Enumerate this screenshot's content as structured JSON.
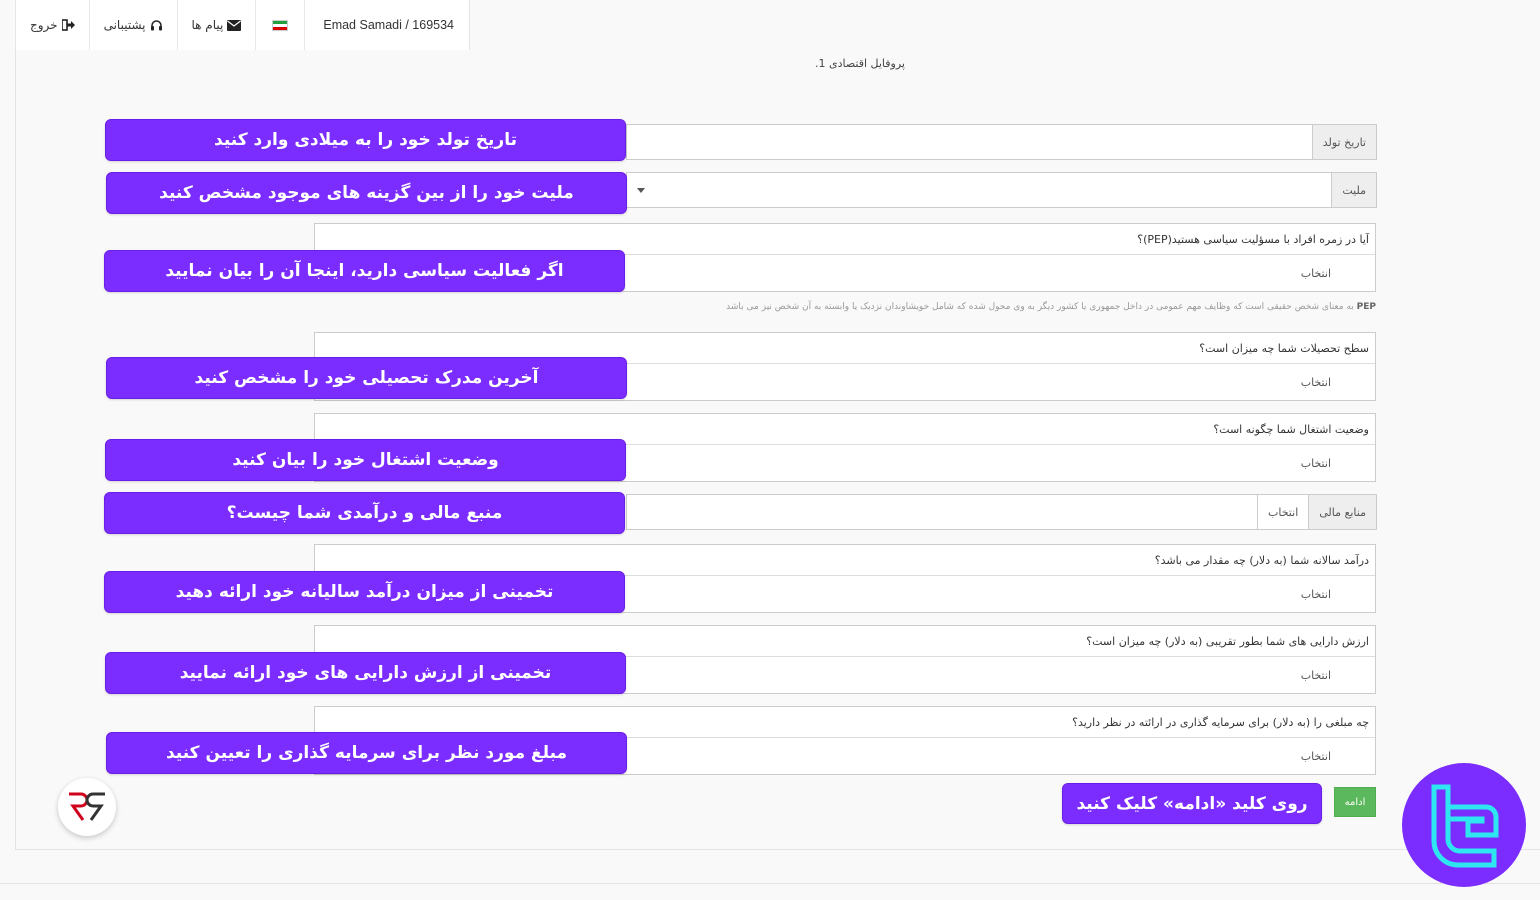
{
  "topbar": {
    "logout": "خروج",
    "support": "پشتیبانی",
    "messages": "پیام ها",
    "user": "Emad Samadi / 169534"
  },
  "section_title": "پروفایل اقتصادی 1.",
  "fields": {
    "birthdate": {
      "addon": "تاریخ تولد",
      "value": ""
    },
    "nationality": {
      "addon": "ملیت",
      "value": ""
    },
    "pep": {
      "label": "آیا در زمره افراد با مسؤلیت سیاسی هستید(PEP)؟",
      "value": "انتخاب"
    },
    "pep_note": {
      "strong": "PEP",
      "text": " به معنای شخص حقیقی است که وظایف مهم عمومی در داخل جمهوری یا کشور دیگر به وی محول شده که شامل خویشاوندان نزدیک یا وابسته به آن شخص نیز می باشد"
    },
    "education": {
      "label": "سطح تحصیلات شما چه میزان است؟",
      "value": "انتخاب"
    },
    "employment": {
      "label": "وضعیت اشتغال شما چگونه است؟",
      "value": "انتخاب"
    },
    "funds": {
      "addon": "منابع مالی",
      "value": "انتخاب"
    },
    "income": {
      "label": "درآمد سالانه شما (به دلار) چه مقدار می باشد؟",
      "value": "انتخاب"
    },
    "assets": {
      "label": "ارزش دارایی های شما بطور تقریبی (به دلار) چه میزان است؟",
      "value": "انتخاب"
    },
    "investment": {
      "label": "چه مبلغی را (به دلار) برای سرمایه گذاری در ارائته در نظر دارید؟",
      "value": "انتخاب"
    }
  },
  "continue_label": "ادامه",
  "callouts": {
    "birthdate": "تاریخ تولد خود را به میلادی وارد کنید",
    "nationality": "ملیت خود را از بین گزینه های موجود مشخص کنید",
    "pep": "اگر فعالیت سیاسی دارید، اینجا آن را بیان نمایید",
    "education": "آخرین مدرک تحصیلی خود را مشخص کنید",
    "employment": "وضعیت اشتغال خود را بیان کنید",
    "funds": "منبع مالی و درآمدی شما چیست؟",
    "income": "تخمینی از میزان درآمد سالیانه خود ارائه دهید",
    "assets": "تخمینی از ارزش دارایی های خود ارائه نمایید",
    "investment": "مبلغ مورد نظر برای سرمایه گذاری را تعیین کنید",
    "continue": "روی کلید «ادامه» کلیک کنید"
  },
  "colors": {
    "callout": "#7b2cff",
    "continue_button": "#5cb85c"
  },
  "icons": [
    "sign-out-icon",
    "headset-icon",
    "envelope-icon",
    "iran-flag-icon"
  ]
}
